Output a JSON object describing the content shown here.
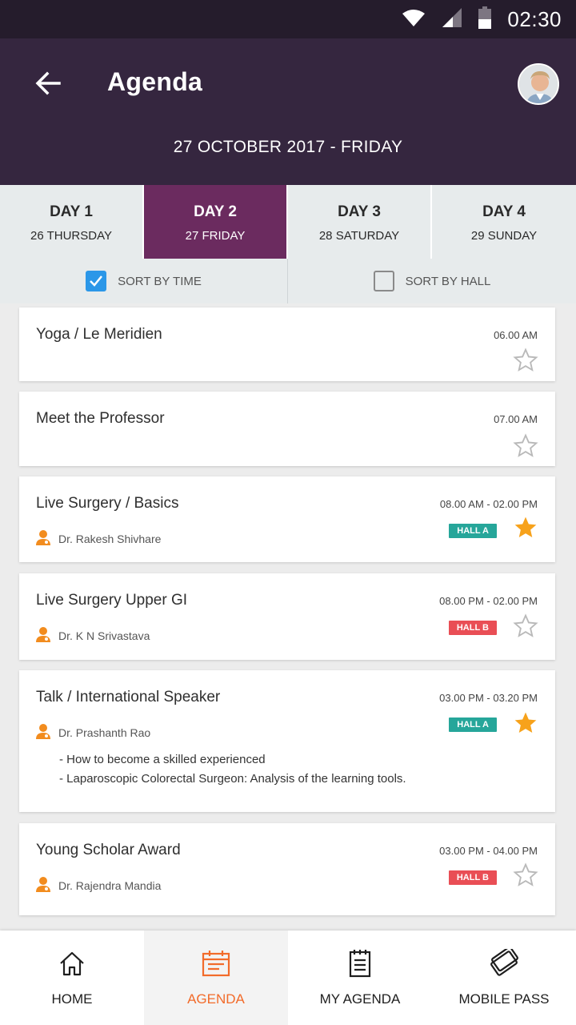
{
  "status_bar": {
    "time": "02:30",
    "icons": [
      "wifi-icon",
      "signal-icon",
      "battery-icon"
    ]
  },
  "header": {
    "title": "Agenda",
    "date": "27 OCTOBER 2017 - FRIDAY"
  },
  "day_tabs": [
    {
      "label": "DAY 1",
      "sub": "26 THURSDAY",
      "active": false
    },
    {
      "label": "DAY 2",
      "sub": "27 FRIDAY",
      "active": true
    },
    {
      "label": "DAY 3",
      "sub": "28 SATURDAY",
      "active": false
    },
    {
      "label": "DAY 4",
      "sub": "29 SUNDAY",
      "active": false
    }
  ],
  "sort": [
    {
      "label": "SORT BY TIME",
      "checked": true
    },
    {
      "label": "SORT BY HALL",
      "checked": false
    }
  ],
  "sessions": [
    {
      "title": "Yoga / Le Meridien",
      "time": "06.00 AM",
      "speaker": "",
      "hall": "",
      "starred": false,
      "notes": []
    },
    {
      "title": "Meet the Professor",
      "time": "07.00 AM",
      "speaker": "",
      "hall": "",
      "starred": false,
      "notes": []
    },
    {
      "title": "Live Surgery / Basics",
      "time": "08.00 AM - 02.00 PM",
      "speaker": "Dr. Rakesh Shivhare",
      "hall": "HALL A",
      "starred": true,
      "notes": []
    },
    {
      "title": "Live Surgery Upper GI",
      "time": "08.00 PM - 02.00 PM",
      "speaker": "Dr. K N Srivastava",
      "hall": "HALL B",
      "starred": false,
      "notes": []
    },
    {
      "title": "Talk / International Speaker",
      "time": "03.00 PM - 03.20 PM",
      "speaker": "Dr. Prashanth Rao",
      "hall": "HALL A",
      "starred": true,
      "notes": [
        "- How to become a skilled experienced",
        "- Laparoscopic Colorectal Surgeon: Analysis of the learning tools."
      ]
    },
    {
      "title": "Young Scholar Award",
      "time": "03.00 PM - 04.00 PM",
      "speaker": "Dr. Rajendra Mandia",
      "hall": "HALL B",
      "starred": false,
      "notes": []
    }
  ],
  "bottom_nav": [
    {
      "label": "HOME",
      "icon": "home-icon",
      "active": false
    },
    {
      "label": "AGENDA",
      "icon": "calendar-icon",
      "active": true
    },
    {
      "label": "MY AGENDA",
      "icon": "notes-icon",
      "active": false
    },
    {
      "label": "MOBILE PASS",
      "icon": "tickets-icon",
      "active": false
    }
  ],
  "colors": {
    "header_bg": "#35263f",
    "status_bg": "#251c2c",
    "active_tab": "#6b2b5f",
    "accent": "#f26b2a",
    "star": "#f7a21b",
    "hall_a": "#26a69a",
    "hall_b": "#e94e55",
    "checkbox": "#2b97e8"
  }
}
